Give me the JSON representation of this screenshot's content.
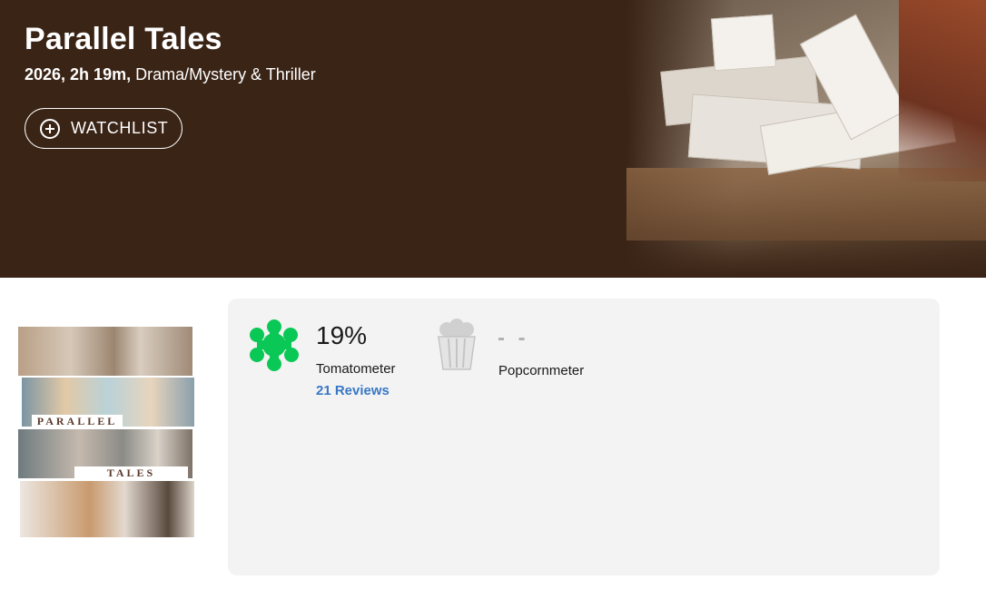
{
  "hero": {
    "title": "Parallel Tales",
    "year_runtime": "2026, 2h 19m,",
    "genres": "Drama/Mystery & Thriller",
    "watchlist_label": "WATCHLIST",
    "background_color": "#3a2416"
  },
  "poster": {
    "words": [
      "PARALLEL",
      "TALES"
    ]
  },
  "scores": {
    "tomatometer": {
      "value": "19%",
      "label": "Tomatometer",
      "reviews": "21 Reviews",
      "icon": "green-splat-icon",
      "color": "#0ac855"
    },
    "popcornmeter": {
      "value": "- -",
      "label": "Popcornmeter",
      "icon": "empty-popcorn-icon"
    }
  },
  "colors": {
    "link": "#3978c4",
    "panel": "#f3f3f3"
  }
}
